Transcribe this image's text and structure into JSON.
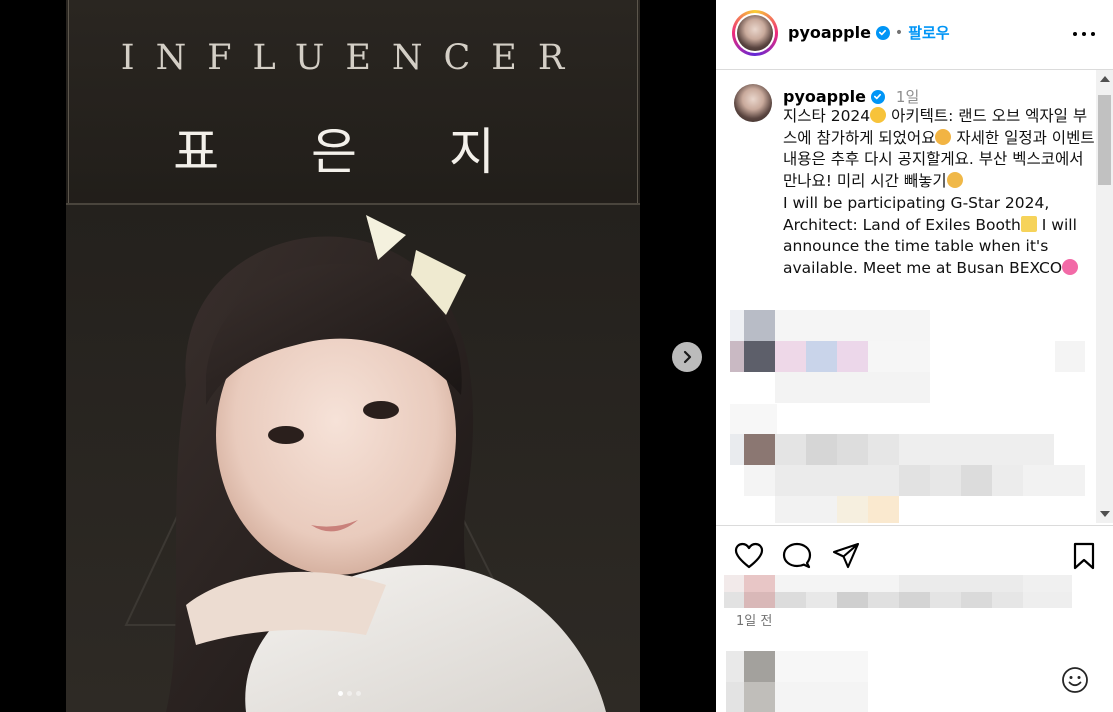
{
  "poster": {
    "label": "INFLUENCER",
    "name": "표 은 지"
  },
  "carousel": {
    "next_icon": "chevron-right-icon",
    "dots": [
      true,
      false,
      false
    ]
  },
  "header": {
    "username": "pyoapple",
    "verified": true,
    "separator": "•",
    "follow_label": "팔로우",
    "more_icon": "more-horizontal-icon"
  },
  "caption": {
    "username": "pyoapple",
    "time": "1일",
    "text_ko_1": "지스타 2024",
    "text_ko_2": " 아키텍트: 랜드 오브 엑자일 부스에 참가하게 되었어요",
    "text_ko_3": " 자세한 일정과 이벤트 내용은 추후 다시 공지할게요. 부산 벡스코에서 만나요! 미리 시간 빼놓기",
    "text_en_1": "I will be participating G-Star 2024, Architect: Land of Exiles Booth",
    "text_en_2": " I will announce the time table when it's available. Meet me at Busan BEXCO"
  },
  "actions": {
    "like_icon": "heart-icon",
    "comment_icon": "comment-icon",
    "share_icon": "send-icon",
    "save_icon": "bookmark-icon"
  },
  "meta": {
    "date": "1일 전",
    "emoji_icon": "smiley-icon"
  },
  "colors": {
    "accent": "#0095f6",
    "border": "#dbdbdb",
    "muted": "#737373"
  }
}
